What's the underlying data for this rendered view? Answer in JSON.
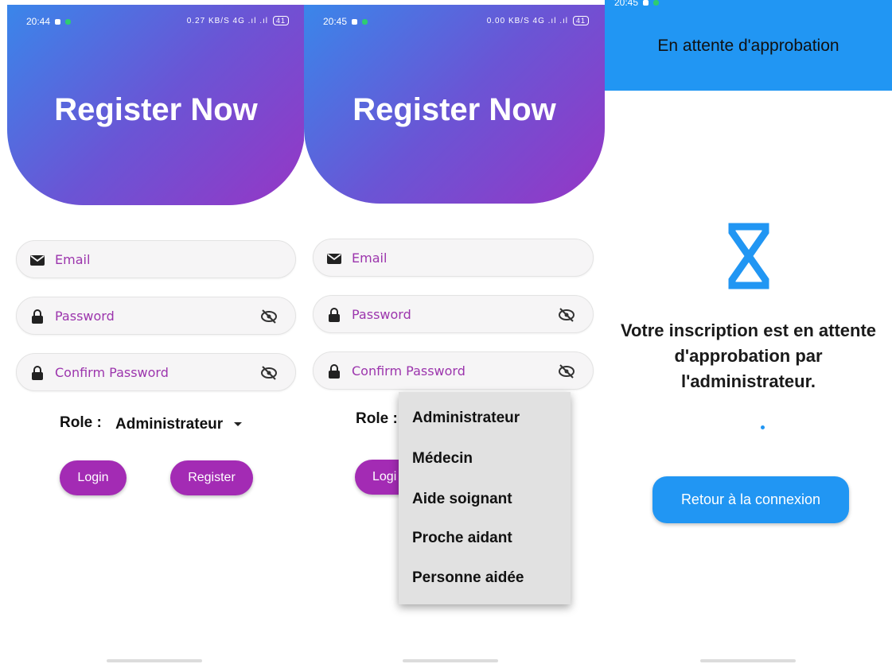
{
  "panel1": {
    "status_time": "20:44",
    "status_right": "0.27 KB/S  4G  .ıl  .ıl",
    "battery": "41",
    "title": "Register Now",
    "email_label": "Email",
    "password_label": "Password",
    "confirm_label": "Confirm Password",
    "role_label": "Role :",
    "role_value": "Administrateur",
    "login_label": "Login",
    "register_label": "Register"
  },
  "panel2": {
    "status_time": "20:45",
    "status_right": "0.00 KB/S  4G  .ıl  .ıl",
    "battery": "41",
    "title": "Register Now",
    "email_label": "Email",
    "password_label": "Password",
    "confirm_label": "Confirm Password",
    "role_label": "Role :",
    "login_label": "Logi",
    "menu_items": [
      "Administrateur",
      "Médecin",
      "Aide soignant",
      "Proche aidant",
      "Personne aidée"
    ]
  },
  "panel3": {
    "status_time": "20:45",
    "header_title": "En attente d'approbation",
    "message_line1": "Votre inscription est en attente",
    "message_line2": "d'approbation par",
    "message_line3": "l'administrateur.",
    "back_button": "Retour à la connexion"
  },
  "colors": {
    "gradient_start": "#3a86ea",
    "gradient_end": "#9636c5",
    "purple_button": "#a32bb4",
    "blue_accent": "#2196f3"
  },
  "icons": [
    "mail-icon",
    "lock-icon",
    "eye-off-icon",
    "dropdown-arrow-icon",
    "hourglass-icon"
  ]
}
